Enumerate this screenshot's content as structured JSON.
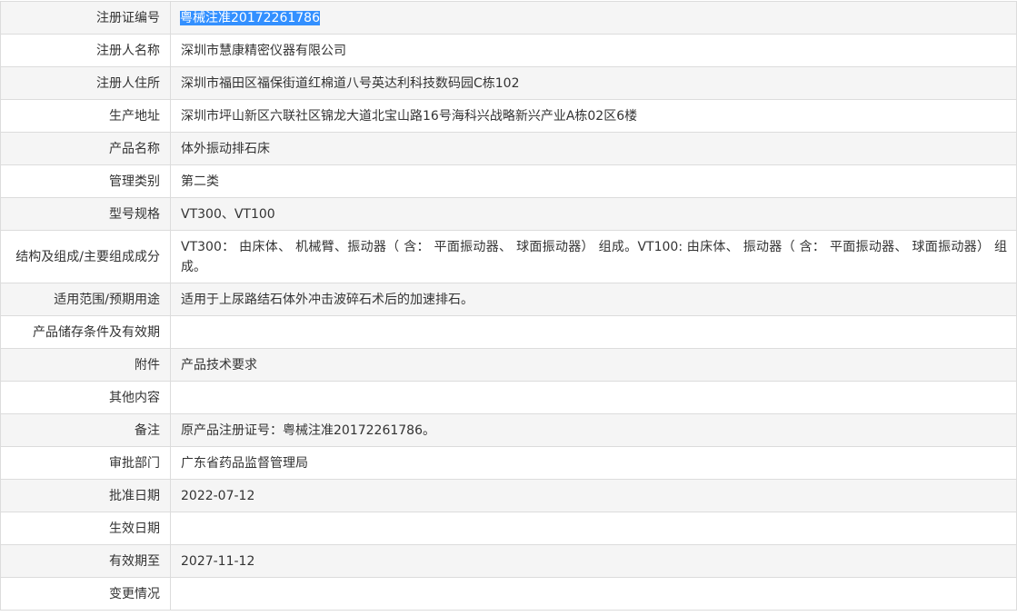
{
  "rows": [
    {
      "label": "注册证编号",
      "value": "粤械注准20172261786",
      "selected": true
    },
    {
      "label": "注册人名称",
      "value": "深圳市慧康精密仪器有限公司"
    },
    {
      "label": "注册人住所",
      "value": "深圳市福田区福保街道红棉道八号英达利科技数码园C栋102"
    },
    {
      "label": "生产地址",
      "value": "深圳市坪山新区六联社区锦龙大道北宝山路16号海科兴战略新兴产业A栋02区6楼"
    },
    {
      "label": "产品名称",
      "value": "体外振动排石床"
    },
    {
      "label": "管理类别",
      "value": "第二类"
    },
    {
      "label": "型号规格",
      "value": "VT300、VT100"
    },
    {
      "label": "结构及组成/主要组成成分",
      "value": "VT300： 由床体、 机械臂、振动器（ 含： 平面振动器、 球面振动器） 组成。VT100: 由床体、 振动器（ 含： 平面振动器、 球面振动器） 组成。"
    },
    {
      "label": "适用范围/预期用途",
      "value": "适用于上尿路结石体外冲击波碎石术后的加速排石。"
    },
    {
      "label": "产品储存条件及有效期",
      "value": ""
    },
    {
      "label": "附件",
      "value": "产品技术要求"
    },
    {
      "label": "其他内容",
      "value": ""
    },
    {
      "label": "备注",
      "value": "原产品注册证号：粤械注准20172261786。"
    },
    {
      "label": "审批部门",
      "value": "广东省药品监督管理局"
    },
    {
      "label": "批准日期",
      "value": "2022-07-12"
    },
    {
      "label": "生效日期",
      "value": ""
    },
    {
      "label": "有效期至",
      "value": "2027-11-12"
    },
    {
      "label": "变更情况",
      "value": ""
    }
  ]
}
